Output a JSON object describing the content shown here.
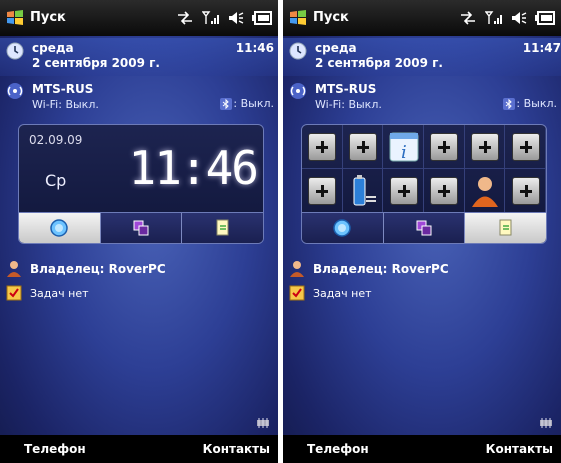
{
  "left": {
    "titlebar": {
      "start_label": "Пуск"
    },
    "date": {
      "day": "среда",
      "full": "2 сентября 2009 г.",
      "time": "11:46"
    },
    "network": {
      "operator": "MTS-RUS",
      "wifi": "Wi-Fi: Выкл.",
      "bt": ": Выкл."
    },
    "clock_panel": {
      "date": "02.09.09",
      "weekday": "Ср",
      "big_time": "11:46"
    },
    "owner": "Владелец: RoverPC",
    "tasks": "Задач нет",
    "softkeys": {
      "left": "Телефон",
      "right": "Контакты"
    }
  },
  "right": {
    "titlebar": {
      "start_label": "Пуск"
    },
    "date": {
      "day": "среда",
      "full": "2 сентября 2009 г.",
      "time": "11:47"
    },
    "network": {
      "operator": "MTS-RUS",
      "wifi": "Wi-Fi: Выкл.",
      "bt": ": Выкл."
    },
    "owner": "Владелец: RoverPC",
    "tasks": "Задач нет",
    "softkeys": {
      "left": "Телефон",
      "right": "Контакты"
    }
  },
  "icons": [
    "windows-start-icon",
    "connectivity-icon",
    "signal-icon",
    "volume-icon",
    "battery-icon",
    "clock-icon",
    "wifi-icon",
    "bluetooth-icon",
    "owner-icon",
    "tasks-icon",
    "sync-tray-icon",
    "plus-icon",
    "info-icon",
    "battery-app-icon",
    "contacts-icon",
    "globe-tab-icon",
    "windows-tab-icon",
    "settings-tab-icon"
  ]
}
